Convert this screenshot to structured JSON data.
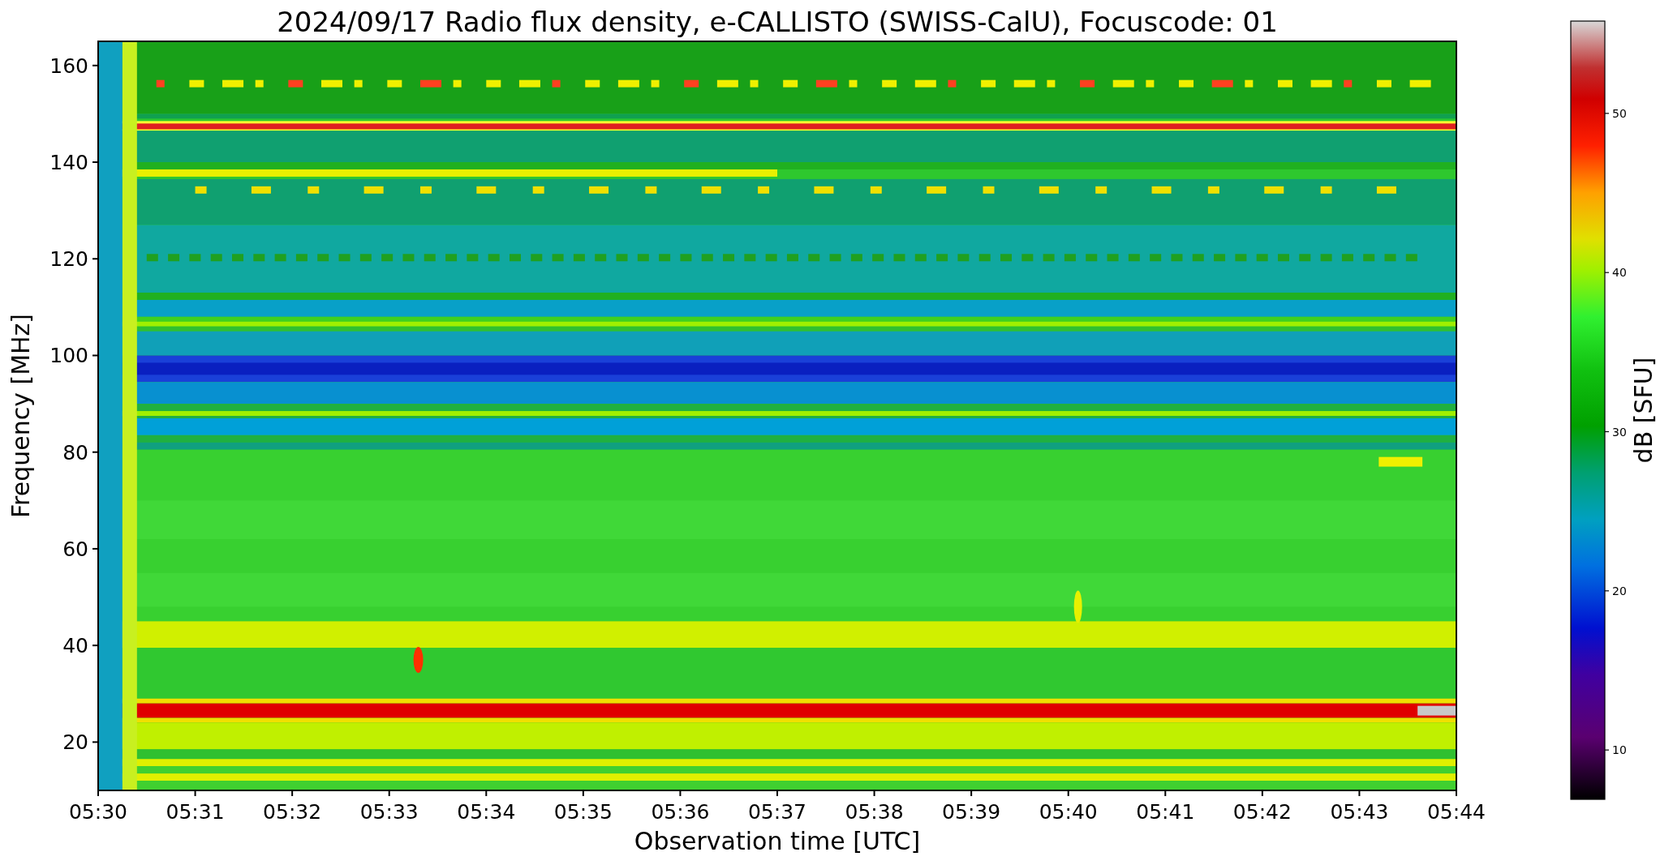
{
  "figure": {
    "title": "2024/09/17  Radio flux density, e-CALLISTO (SWISS-CalU), Focuscode: 01",
    "xlabel": "Observation time [UTC]",
    "ylabel": "Frequency [MHz]",
    "xtick_labels": [
      "05:30",
      "05:31",
      "05:32",
      "05:33",
      "05:34",
      "05:35",
      "05:36",
      "05:37",
      "05:38",
      "05:39",
      "05:40",
      "05:41",
      "05:42",
      "05:43",
      "05:44"
    ],
    "ytick_labels": [
      "160",
      "140",
      "120",
      "100",
      "80",
      "60",
      "40",
      "20"
    ],
    "colorbar": {
      "label": "dB [SFU]",
      "tick_labels": [
        "50",
        "40",
        "30",
        "20",
        "10"
      ]
    }
  }
}
